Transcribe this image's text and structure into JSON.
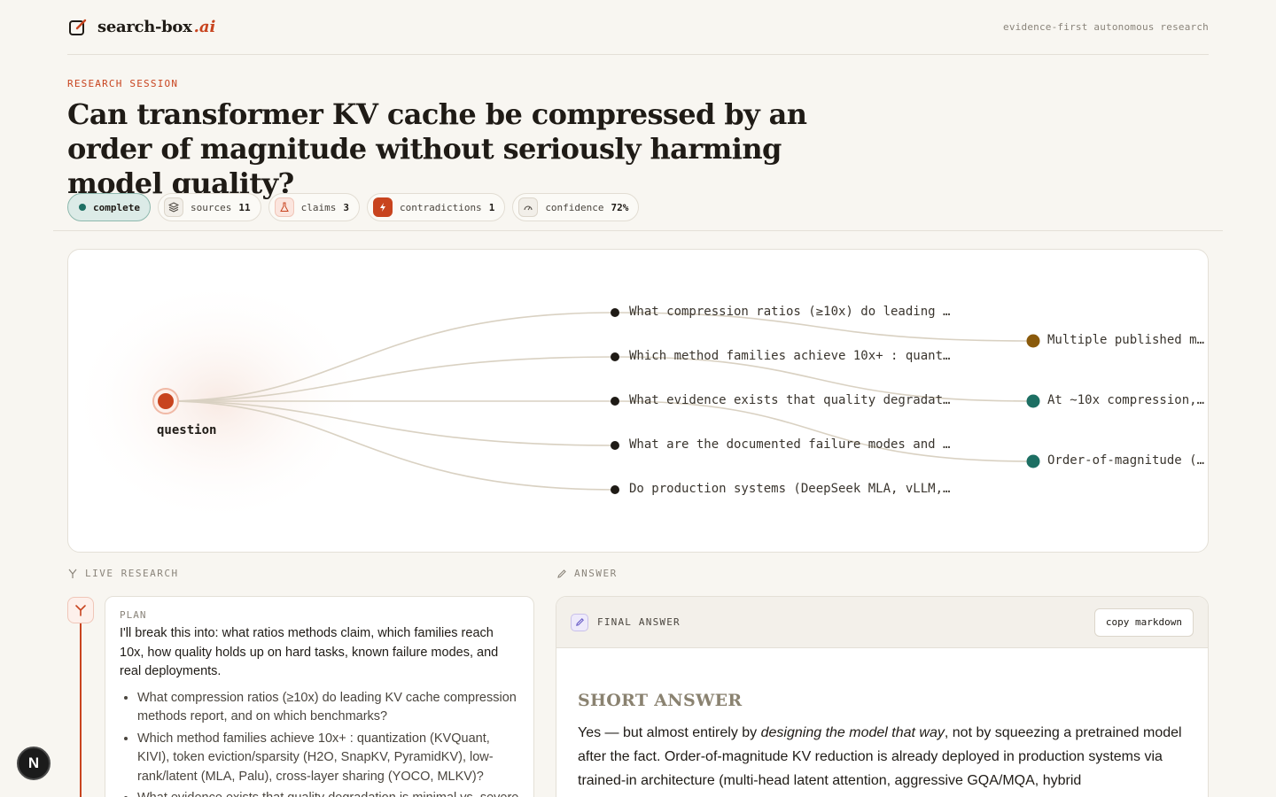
{
  "brand": {
    "name": "search-box",
    "suffix": ".ai",
    "tagline": "evidence-first autonomous research"
  },
  "session": {
    "label": "RESEARCH SESSION",
    "question": "Can transformer KV cache be compressed by an order of magnitude without seriously harming model quality?"
  },
  "stats": {
    "status": "complete",
    "sources_label": "sources",
    "sources_value": "11",
    "claims_label": "claims",
    "claims_value": "3",
    "contradictions_label": "contradictions",
    "contradictions_value": "1",
    "confidence_label": "confidence",
    "confidence_value": "72%"
  },
  "graph": {
    "root_label": "question",
    "subquestions": [
      "What compression ratios (≥10x) do leading K…",
      "Which method families achieve 10x+ : quanti…",
      "What evidence exists that quality degradati…",
      "What are the documented failure modes and c…",
      "Do production systems (DeepSeek MLA, vLLM, …"
    ],
    "claims": [
      {
        "text": "Multiple published me…",
        "color": "#8a5a0b"
      },
      {
        "text": "At ~10x compression, …",
        "color": "#1d6f63"
      },
      {
        "text": "Order-of-magnitude (~…",
        "color": "#1d6f63"
      }
    ],
    "colors": {
      "root": "#c8441f",
      "edge": "#d9d1c2",
      "node": "#1f1b16"
    }
  },
  "live": {
    "heading": "LIVE RESEARCH",
    "plan_label": "PLAN",
    "plan_text": "I'll break this into: what ratios methods claim, which families reach 10x, how quality holds up on hard tasks, known failure modes, and real deployments.",
    "plan_items": [
      "What compression ratios (≥10x) do leading KV cache compression methods report, and on which benchmarks?",
      "Which method families achieve 10x+ : quantization (KVQuant, KIVI), token eviction/sparsity (H2O, SnapKV, PyramidKV), low-rank/latent (MLA, Palu), cross-layer sharing (YOCO, MLKV)?",
      "What evidence exists that quality degradation is minimal vs. severe"
    ]
  },
  "answer": {
    "heading": "ANSWER",
    "card_title": "FINAL ANSWER",
    "copy_label": "copy markdown",
    "short_heading": "SHORT ANSWER",
    "text_before": "Yes — but almost entirely by ",
    "text_em": "designing the model that way",
    "text_after": ", not by squeezing a pretrained model after the fact. Order-of-magnitude KV reduction is already deployed in production systems via trained-in architecture (multi-head latent attention, aggressive GQA/MQA, hybrid"
  },
  "next_badge": "N"
}
